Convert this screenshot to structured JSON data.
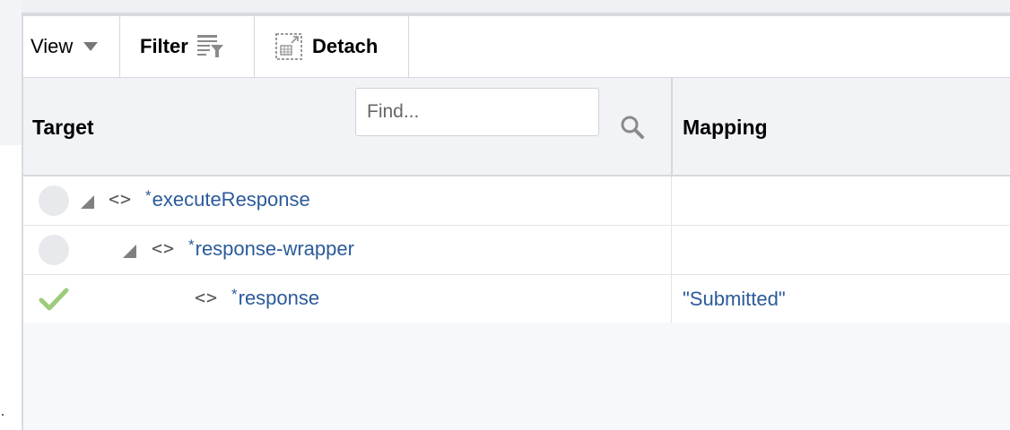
{
  "toolbar": {
    "view_label": "View",
    "filter_label": "Filter",
    "detach_label": "Detach"
  },
  "header": {
    "target_label": "Target",
    "mapping_label": "Mapping",
    "search_placeholder": "Find..."
  },
  "rows": [
    {
      "status": "empty",
      "expanded": true,
      "name": "executeResponse",
      "required_mark": "*",
      "mapping": ""
    },
    {
      "status": "empty",
      "expanded": true,
      "name": "response-wrapper",
      "required_mark": "*",
      "mapping": ""
    },
    {
      "status": "mapped",
      "expanded": null,
      "name": "response",
      "required_mark": "*",
      "mapping": "\"Submitted\""
    }
  ],
  "icons": {
    "view_caret": "chevron-down-icon",
    "filter": "filter-icon",
    "detach": "detach-icon",
    "search": "search-icon",
    "expand": "expand-triangle-icon",
    "element": "code-brackets-icon",
    "mapped": "checkmark-icon"
  },
  "colors": {
    "link": "#2b5b9a",
    "check": "#9ccc7a"
  }
}
